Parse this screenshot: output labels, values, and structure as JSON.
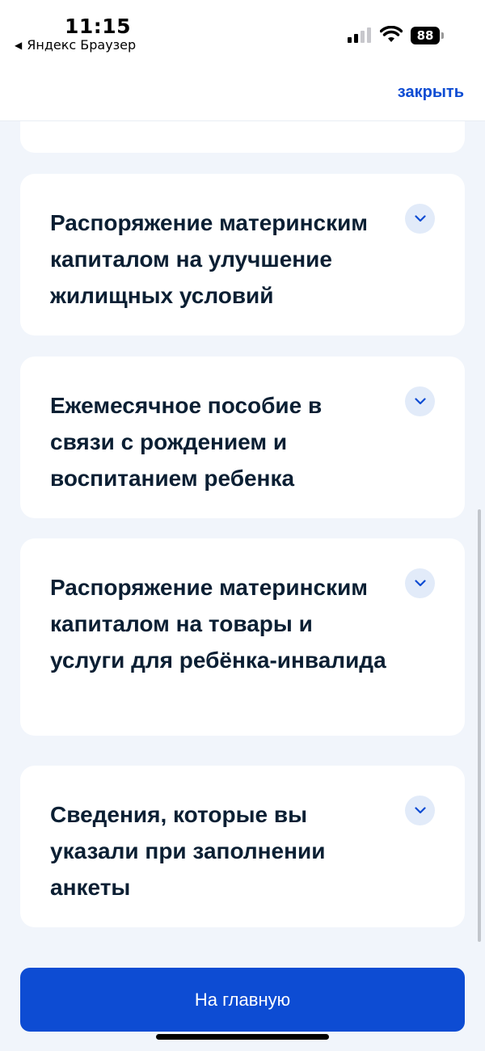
{
  "status_bar": {
    "time": "11:15",
    "back_app": "Яндекс Браузер",
    "battery": "88",
    "signal_icon": "cellular-signal-icon",
    "wifi_icon": "wifi-icon"
  },
  "header": {
    "close_label": "закрыть"
  },
  "cards": [
    {
      "title": "Распоряжение материнским капиталом на улучшение жилищных условий",
      "icon": "chevron-down-icon"
    },
    {
      "title": "Ежемесячное пособие в связи с рождением и воспитанием ребенка",
      "icon": "chevron-down-icon"
    },
    {
      "title": "Распоряжение материнским капиталом на товары и услуги для ребёнка-инвалида",
      "icon": "chevron-down-icon"
    },
    {
      "title": "Сведения, которые вы указали при заполнении анкеты",
      "icon": "chevron-down-icon"
    }
  ],
  "footer": {
    "home_button": "На главную"
  },
  "colors": {
    "accent": "#0d4cd3",
    "background": "#f1f5fb",
    "chevron_bg": "#e2ebf9"
  }
}
